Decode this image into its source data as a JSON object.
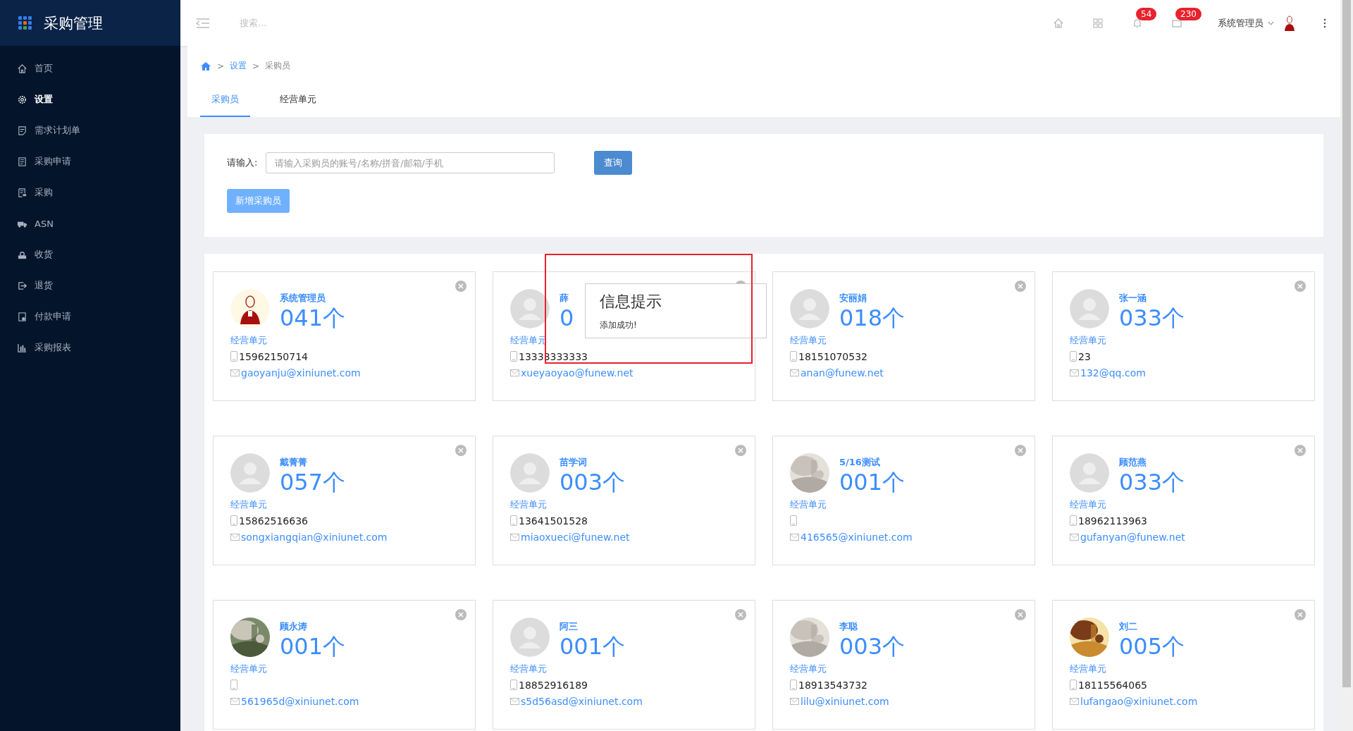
{
  "app": {
    "title": "采购管理"
  },
  "sidebar": {
    "items": [
      {
        "label": "首页",
        "selected": false
      },
      {
        "label": "设置",
        "selected": true
      },
      {
        "label": "需求计划单",
        "selected": false
      },
      {
        "label": "采购申请",
        "selected": false
      },
      {
        "label": "采购",
        "selected": false
      },
      {
        "label": "ASN",
        "selected": false
      },
      {
        "label": "收货",
        "selected": false
      },
      {
        "label": "退货",
        "selected": false
      },
      {
        "label": "付款申请",
        "selected": false
      },
      {
        "label": "采购报表",
        "selected": false
      }
    ]
  },
  "header": {
    "search_placeholder": "搜索...",
    "notifications": "54",
    "messages": "230",
    "user": "系统管理员"
  },
  "breadcrumb": [
    {
      "separator": ">",
      "label": "设置"
    },
    {
      "separator": ">",
      "label": "采购员"
    }
  ],
  "tabs": [
    {
      "label": "采购员",
      "selected": true
    },
    {
      "label": "经营单元",
      "selected": false
    }
  ],
  "search": {
    "label": "请输入:",
    "placeholder": "请输入采购员的账号/名称/拼音/邮箱/手机",
    "button": "查询",
    "add_button": "新增采购员"
  },
  "cards": [
    {
      "name": "系统管理员",
      "count": "041个",
      "unit": "经营单元",
      "phone": "15962150714",
      "email": "gaoyanju@xiniunet.com",
      "kind": "figure"
    },
    {
      "name": "薛",
      "count": "0",
      "unit": "经营单元",
      "phone": "13333333333",
      "email": "xueyaoyao@funew.net",
      "kind": "default"
    },
    {
      "name": "安丽娟",
      "count": "018个",
      "unit": "经营单元",
      "phone": "18151070532",
      "email": "anan@funew.net",
      "kind": "default"
    },
    {
      "name": "张一涵",
      "count": "033个",
      "unit": "经营单元",
      "phone": "23",
      "email": "132@qq.com",
      "kind": "default"
    },
    {
      "name": "戴菁菁",
      "count": "057个",
      "unit": "经营单元",
      "phone": "15862516636",
      "email": "songxiangqian@xiniunet.com",
      "kind": "default"
    },
    {
      "name": "苗学词",
      "count": "003个",
      "unit": "经营单元",
      "phone": "13641501528",
      "email": "miaoxueci@funew.net",
      "kind": "default"
    },
    {
      "name": "5/16测试",
      "count": "001个",
      "unit": "经营单元",
      "email": "416565@xiniunet.com",
      "kind": "picture"
    },
    {
      "name": "顾范燕",
      "count": "033个",
      "unit": "经营单元",
      "phone": "18962113963",
      "email": "gufanyan@funew.net",
      "kind": "default"
    },
    {
      "name": "顾永涛",
      "count": "001个",
      "unit": "经营单元",
      "email": "561965d@xiniunet.com",
      "kind": "picture"
    },
    {
      "name": "阿三",
      "count": "001个",
      "unit": "经营单元",
      "phone": "18852916189",
      "email": "s5d56asd@xiniunet.com",
      "kind": "default"
    },
    {
      "name": "李聪",
      "count": "003个",
      "unit": "经营单元",
      "phone": "18913543732",
      "email": "lilu@xiniunet.com",
      "kind": "picture"
    },
    {
      "name": "刘二",
      "count": "005个",
      "unit": "经营单元",
      "phone": "18115564065",
      "email": "lufangao@xiniunet.com",
      "kind": "picture"
    }
  ],
  "popup": {
    "title": "信息提示",
    "message": "添加成功!"
  }
}
